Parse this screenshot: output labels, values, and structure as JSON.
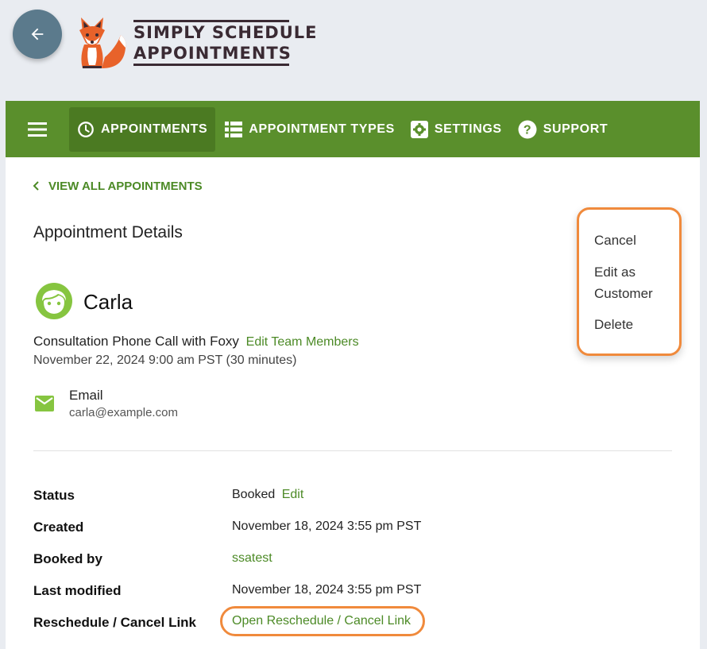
{
  "header": {
    "back_icon": "arrow-left-icon",
    "logo_line1": "SIMPLY SCHEDULE",
    "logo_line2": "APPOINTMENTS"
  },
  "nav": {
    "menu_icon": "hamburger-icon",
    "items": [
      {
        "label": "APPOINTMENTS",
        "icon": "clock-icon",
        "active": true
      },
      {
        "label": "APPOINTMENT TYPES",
        "icon": "list-icon",
        "active": false
      },
      {
        "label": "SETTINGS",
        "icon": "gear-icon",
        "active": false
      },
      {
        "label": "SUPPORT",
        "icon": "help-icon",
        "active": false
      }
    ]
  },
  "main": {
    "view_all": "VIEW ALL APPOINTMENTS",
    "title": "Appointment Details",
    "customer_name": "Carla",
    "appointment_type": "Consultation Phone Call with Foxy",
    "edit_team_members": "Edit Team Members",
    "appointment_datetime": "November 22, 2024 9:00 am PST (30 minutes)",
    "email_label": "Email",
    "email_value": "carla@example.com"
  },
  "details": {
    "status_label": "Status",
    "status_value": "Booked",
    "status_edit": "Edit",
    "created_label": "Created",
    "created_value": "November 18, 2024 3:55 pm PST",
    "booked_by_label": "Booked by",
    "booked_by_value": "ssatest",
    "modified_label": "Last modified",
    "modified_value": "November 18, 2024 3:55 pm PST",
    "reschedule_label": "Reschedule / Cancel Link",
    "reschedule_value": "Open Reschedule / Cancel Link"
  },
  "menu": {
    "cancel": "Cancel",
    "edit_as_1": "Edit as",
    "edit_as_2": "Customer",
    "delete": "Delete"
  },
  "colors": {
    "nav_green": "#5a8f2c",
    "link_green": "#4c8a26",
    "highlight_orange": "#f08a3c",
    "back_button": "#5b7a8c"
  }
}
